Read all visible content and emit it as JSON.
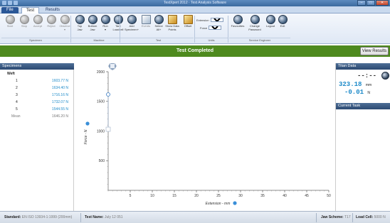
{
  "window": {
    "title": "TestXpert 2012 · Test Analysis Software"
  },
  "tabs": {
    "file": "File",
    "test": "Test",
    "results": "Results"
  },
  "ribbon": {
    "specimen_buttons": [
      {
        "label": "Start",
        "icon": "start-icon"
      },
      {
        "label": "Stop",
        "icon": "stop-icon"
      },
      {
        "label": "Accept",
        "icon": "accept-icon"
      },
      {
        "label": "Reject",
        "icon": "reject-icon"
      },
      {
        "label": "Observe\n▾",
        "icon": "observe-icon"
      }
    ],
    "machine_buttons": [
      {
        "label": "Top\nJaw",
        "icon": "top-jaw-icon"
      },
      {
        "label": "Bottom\nJaw",
        "icon": "bottom-jaw-icon"
      },
      {
        "label": "Run\n▾",
        "icon": "run-icon"
      },
      {
        "label": "Tare\nLoadcell",
        "icon": "tare-icon"
      }
    ],
    "test_buttons": [
      {
        "label": "Add\nSpecimen+",
        "icon": "add-specimen-icon"
      },
      {
        "label": "Events",
        "icon": "events-icon"
      },
      {
        "label": "Select\nAll+",
        "icon": "select-all-icon"
      },
      {
        "label": "Show Data\nPoints",
        "icon": "show-data-points-icon"
      },
      {
        "label": "Offset",
        "icon": "offset-icon"
      }
    ],
    "units": {
      "extension_label": "Extension",
      "extension_value": "mm",
      "force_label": "Force",
      "force_value": "N"
    },
    "service_buttons": [
      {
        "label": "Favourites",
        "icon": "favourites-icon"
      },
      {
        "label": "Change\nPassword",
        "icon": "change-password-icon"
      },
      {
        "label": "Logout",
        "icon": "logout-icon"
      },
      {
        "label": "Exit",
        "icon": "exit-icon"
      }
    ],
    "groups": {
      "specimen": "Specimen",
      "machine": "Machine",
      "test": "Test",
      "units": "Units",
      "service": "Service Engineer"
    }
  },
  "banner": {
    "text": "Test Completed",
    "color": "#4e8a1e"
  },
  "view_results_label": "View Results",
  "specimens": {
    "header": "Specimens",
    "group_label": "Weft",
    "rows": [
      {
        "n": "1",
        "value": "1603.77 N"
      },
      {
        "n": "2",
        "value": "1634.40 N"
      },
      {
        "n": "3",
        "value": "1716.16 N"
      },
      {
        "n": "4",
        "value": "1732.07 N"
      },
      {
        "n": "5",
        "value": "1544.55 N"
      }
    ],
    "mean": {
      "label": "Mean",
      "value": "1646.20 N"
    }
  },
  "titan": {
    "header": "Titan Data",
    "time": "--:--",
    "extension": "323.18",
    "extension_unit": "mm",
    "force": "-0.01",
    "force_unit": "N"
  },
  "current_task": {
    "header": "Current Task"
  },
  "chart_data": {
    "type": "line",
    "xlabel": "Extension - mm",
    "ylabel": "Force - N",
    "xlim": [
      0,
      50
    ],
    "ylim": [
      0,
      2000
    ],
    "x_ticks": [
      5,
      10,
      15,
      20,
      25,
      30,
      35,
      40,
      45,
      50
    ],
    "y_ticks": [
      500,
      1000,
      1500,
      2000
    ],
    "series": [],
    "grid": false
  },
  "statusbar": {
    "standard_label": "Standard:",
    "standard_value": "EN ISO 13934-1:1999 (200mm)",
    "test_name_label": "Test Name:",
    "test_name_value": "July 12 051",
    "jaw_label": "Jaw Scheme:",
    "jaw_value": "T17",
    "loadcell_label": "Load Cell:",
    "loadcell_value": "5000 N"
  }
}
